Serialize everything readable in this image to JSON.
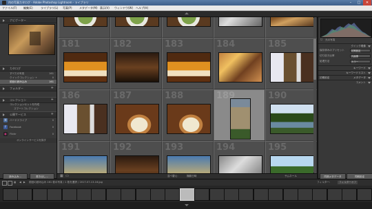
{
  "window": {
    "title": "内の写真カタログ - Adobe Photoshop Lightroom - ライブラリ",
    "minimize": "–",
    "maximize": "□",
    "close": "✕"
  },
  "menu": [
    "ファイル(F)",
    "編集(E)",
    "ライブラリ(L)",
    "写真(P)",
    "メタデータ(M)",
    "表示(V)",
    "ウィンドウ(W)",
    "ヘルプ(H)"
  ],
  "left_panel": {
    "navigator_label": "ナビゲーター",
    "catalog_label": "カタログ",
    "catalog_items": [
      {
        "label": "すべての写真",
        "count": "161"
      },
      {
        "label": "クイックコレクション +",
        "count": "0"
      },
      {
        "label": "前回の読み込み",
        "count": "161"
      }
    ],
    "folders_label": "フォルダー",
    "collections_label": "コレクション",
    "collection_items": [
      {
        "label": "コレクションセットを作成",
        "count": ""
      },
      {
        "label": "スマートコレクション",
        "count": ""
      }
    ],
    "publish_label": "公開サービス",
    "publish_items": [
      {
        "label": "ハードドライブ",
        "count": "0",
        "badge": "H",
        "badge_color": "#4a6a9a"
      },
      {
        "label": "Facebook",
        "count": "0",
        "badge": "f",
        "badge_color": "#3b5998"
      },
      {
        "label": "Flickr",
        "count": "0",
        "badge": "●",
        "badge_color": "#c0337a"
      },
      {
        "label": "オンラインサービスを探す",
        "count": "",
        "badge": "",
        "badge_color": ""
      }
    ],
    "import_button": "読み込み...",
    "export_button": "書き出し..."
  },
  "grid": {
    "cells": [
      {
        "num": "",
        "thumb": "t-salad",
        "w": 62,
        "h": 30
      },
      {
        "num": "",
        "thumb": "t-salad",
        "w": 62,
        "h": 30
      },
      {
        "num": "",
        "thumb": "t-salad",
        "w": 62,
        "h": 30
      },
      {
        "num": "",
        "thumb": "t-gray",
        "w": 62,
        "h": 30
      },
      {
        "num": "",
        "thumb": "t-wood",
        "w": 62,
        "h": 30
      },
      {
        "num": "181",
        "thumb": "t-drinks",
        "w": 62,
        "h": 42
      },
      {
        "num": "182",
        "thumb": "t-dark",
        "w": 62,
        "h": 42
      },
      {
        "num": "183",
        "thumb": "t-drinks",
        "w": 62,
        "h": 42
      },
      {
        "num": "184",
        "thumb": "t-cafe",
        "w": 62,
        "h": 42
      },
      {
        "num": "185",
        "thumb": "t-bright",
        "w": 62,
        "h": 42
      },
      {
        "num": "186",
        "thumb": "t-bright",
        "w": 62,
        "h": 42
      },
      {
        "num": "187",
        "thumb": "t-plate",
        "w": 62,
        "h": 42
      },
      {
        "num": "188",
        "thumb": "t-plate",
        "w": 62,
        "h": 42
      },
      {
        "num": "189",
        "thumb": "t-lantern",
        "w": 28,
        "h": 58
      },
      {
        "num": "190",
        "thumb": "t-park",
        "w": 62,
        "h": 42
      },
      {
        "num": "191",
        "thumb": "t-sky",
        "w": 62,
        "h": 42
      },
      {
        "num": "192",
        "thumb": "t-dark",
        "w": 62,
        "h": 42
      },
      {
        "num": "193",
        "thumb": "t-sky",
        "w": 62,
        "h": 42
      },
      {
        "num": "194",
        "thumb": "t-gray",
        "w": 62,
        "h": 42
      },
      {
        "num": "195",
        "thumb": "t-garden",
        "w": 62,
        "h": 42
      }
    ],
    "selected_index": 13
  },
  "grid_toolbar": {
    "sort_label": "並べ替え:",
    "sort_value": "撮影日時",
    "thumbs_label": "サムネール"
  },
  "right_panel": {
    "original_label": "元の写真",
    "quick_develop_label": "クイック現像",
    "rows": [
      {
        "label": "保存済みのプリセット",
        "value": "初期設定"
      },
      {
        "label": "切り抜き比率",
        "value": "元画像"
      },
      {
        "label": "処理方法",
        "value": "カラー"
      }
    ],
    "keywording_label": "キーワード",
    "keyword_list_label": "キーワードリスト",
    "metadata_label": "メタデータ",
    "metadata_value": "初期設定",
    "comments_label": "コメント",
    "sync_button": "同期設定",
    "sync_meta_button": "同期メタデータ"
  },
  "filmstrip_bar": {
    "source": "前回の読み込み  161 枚の写真 / 1 枚を選択 / 2017-07-13-16.jpg",
    "filter_label": "フィルター:",
    "filter_value": "フィルターオフ"
  },
  "filmstrip": {
    "count": 25,
    "selected_index": 12,
    "thumbs": [
      "t-dark",
      "t-cafe",
      "t-drinks",
      "t-plate",
      "t-wood",
      "t-bright",
      "t-salad",
      "t-table",
      "t-cafe",
      "t-drinks",
      "t-plate",
      "t-bright",
      "t-lantern",
      "t-park",
      "t-wood",
      "t-salad",
      "t-dark",
      "t-cafe",
      "t-drinks",
      "t-plate",
      "t-bright",
      "t-garden",
      "t-sky",
      "t-table",
      "t-wood"
    ]
  }
}
